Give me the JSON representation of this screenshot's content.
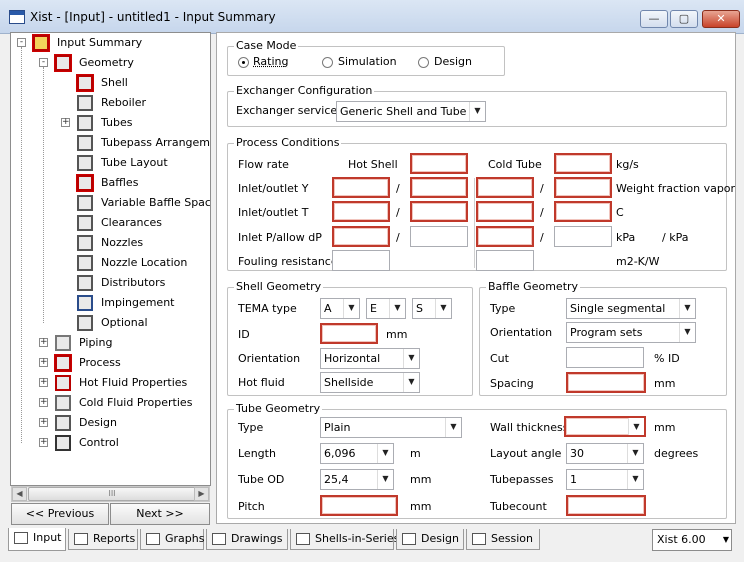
{
  "window": {
    "title": "Xist - [Input] - untitled1 - Input Summary",
    "minimize": "—",
    "maximize": "▢",
    "close": "✕"
  },
  "tree": {
    "items": [
      {
        "label": "Input Summary",
        "icon": "input-summary-icon"
      },
      {
        "label": "Geometry",
        "icon": "geometry-icon"
      },
      {
        "label": "Shell",
        "icon": "shell-icon"
      },
      {
        "label": "Reboiler",
        "icon": "reboiler-icon"
      },
      {
        "label": "Tubes",
        "icon": "tubes-icon"
      },
      {
        "label": "Tubepass Arrangem",
        "icon": "tubepass-icon"
      },
      {
        "label": "Tube Layout",
        "icon": "tube-layout-icon"
      },
      {
        "label": "Baffles",
        "icon": "baffles-icon"
      },
      {
        "label": "Variable Baffle Spaci",
        "icon": "variable-baffle-icon"
      },
      {
        "label": "Clearances",
        "icon": "clearances-icon"
      },
      {
        "label": "Nozzles",
        "icon": "nozzles-icon"
      },
      {
        "label": "Nozzle Location",
        "icon": "nozzle-location-icon"
      },
      {
        "label": "Distributors",
        "icon": "distributors-icon"
      },
      {
        "label": "Impingement",
        "icon": "impingement-icon"
      },
      {
        "label": "Optional",
        "icon": "optional-icon"
      },
      {
        "label": "Piping",
        "icon": "piping-icon"
      },
      {
        "label": "Process",
        "icon": "process-icon"
      },
      {
        "label": "Hot Fluid Properties",
        "icon": "hot-fluid-icon"
      },
      {
        "label": "Cold Fluid Properties",
        "icon": "cold-fluid-icon"
      },
      {
        "label": "Design",
        "icon": "design-icon"
      },
      {
        "label": "Control",
        "icon": "control-icon"
      }
    ],
    "scroll_thumb": "III",
    "prev_label": "<< Previous",
    "next_label": "Next >>"
  },
  "case_mode": {
    "title": "Case Mode",
    "options": [
      "Rating",
      "Simulation",
      "Design"
    ],
    "selected": "Rating"
  },
  "exchanger": {
    "title": "Exchanger Configuration",
    "service_label": "Exchanger service",
    "service_value": "Generic Shell and Tube"
  },
  "process": {
    "title": "Process Conditions",
    "flow_rate": "Flow rate",
    "hot_shell": "Hot Shell",
    "cold_tube": "Cold Tube",
    "unit_flow": "kg/s",
    "inlet_outlet_y": "Inlet/outlet Y",
    "unit_y": "Weight fraction vapor",
    "inlet_outlet_t": "Inlet/outlet T",
    "unit_t": "C",
    "inlet_p": "Inlet P/allow dP",
    "unit_p1": "kPa",
    "unit_p2": "/  kPa",
    "fouling": "Fouling resistance",
    "unit_fouling": "m2-K/W",
    "slash": "/"
  },
  "shell_geometry": {
    "title": "Shell Geometry",
    "tema_label": "TEMA type",
    "tema": [
      "A",
      "E",
      "S"
    ],
    "id_label": "ID",
    "id_unit": "mm",
    "orientation_label": "Orientation",
    "orientation": "Horizontal",
    "hot_fluid_label": "Hot fluid",
    "hot_fluid": "Shellside"
  },
  "baffle_geometry": {
    "title": "Baffle Geometry",
    "type_label": "Type",
    "type": "Single segmental",
    "orientation_label": "Orientation",
    "orientation": "Program sets",
    "cut_label": "Cut",
    "cut_unit": "% ID",
    "spacing_label": "Spacing",
    "spacing_unit": "mm"
  },
  "tube_geometry": {
    "title": "Tube Geometry",
    "type_label": "Type",
    "type": "Plain",
    "length_label": "Length",
    "length": "6,096",
    "length_unit": "m",
    "od_label": "Tube OD",
    "od": "25,4",
    "od_unit": "mm",
    "pitch_label": "Pitch",
    "pitch_unit": "mm",
    "wall_label": "Wall thickness",
    "wall_unit": "mm",
    "layout_label": "Layout angle",
    "layout": "30",
    "layout_unit": "degrees",
    "passes_label": "Tubepasses",
    "passes": "1",
    "count_label": "Tubecount"
  },
  "tabs": [
    "Input",
    "Reports",
    "Graphs",
    "Drawings",
    "Shells-in-Series",
    "Design",
    "Session"
  ],
  "active_tab": "Input",
  "version": "Xist 6.00",
  "colors": {
    "required_border": "#c0392b",
    "title_gradient": "#dbe6f4"
  }
}
